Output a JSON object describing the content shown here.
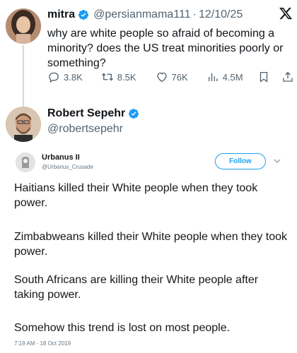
{
  "tweet": {
    "author_name": "mitra",
    "handle": "@persianmama111",
    "date": "12/10/25",
    "separator": "·",
    "text": "why are white people so afraid of becoming a minority? does the US treat minorities poorly or something?",
    "stats": {
      "replies": "3.8K",
      "reposts": "8.5K",
      "likes": "76K",
      "views": "4.5M"
    }
  },
  "reply": {
    "author_name": "Robert Sepehr",
    "handle": "@robertsepehr"
  },
  "embedded_tweet": {
    "author_name": "Urbanus II",
    "handle": "@Urbanus_Crusade",
    "follow_label": "Follow",
    "paragraphs": [
      "Haitians killed their White people when they took power.",
      "Zimbabweans killed their White people when they took power.",
      "South Africans are killing their White people after taking power.",
      "Somehow this trend is lost on most people."
    ],
    "timestamp": "7:19 AM - 18 Oct 2019"
  },
  "icons": {
    "verified": "verified-badge-icon",
    "x_logo": "x-logo-icon",
    "reply": "reply-icon",
    "repost": "repost-icon",
    "like": "heart-icon",
    "views": "views-icon",
    "bookmark": "bookmark-icon",
    "share": "share-icon"
  },
  "colors": {
    "verified_blue": "#1d9bf0",
    "secondary_text": "#536471",
    "follow_blue": "#1da1f2"
  }
}
